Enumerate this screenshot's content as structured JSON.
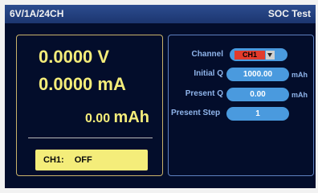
{
  "header": {
    "model": "6V/1A/24CH",
    "mode": "SOC Test"
  },
  "readings": {
    "voltage": "0.0000 V",
    "current": "0.0000 mA",
    "capacity_value": "0.00",
    "capacity_unit": "mAh"
  },
  "status": {
    "channel": "CH1:",
    "state": "OFF"
  },
  "settings": {
    "channel_label": "Channel",
    "channel_value": "CH1",
    "initial_q_label": "Initial Q",
    "initial_q_value": "1000.00",
    "initial_q_unit": "mAh",
    "present_q_label": "Present Q",
    "present_q_value": "0.00",
    "present_q_unit": "mAh",
    "present_step_label": "Present Step",
    "present_step_value": "1"
  },
  "colors": {
    "background": "#030d2b",
    "readout": "#f4ed7a",
    "label": "#8fb4ea",
    "pill": "#4a9ade",
    "channel_select": "#e23b2c"
  }
}
